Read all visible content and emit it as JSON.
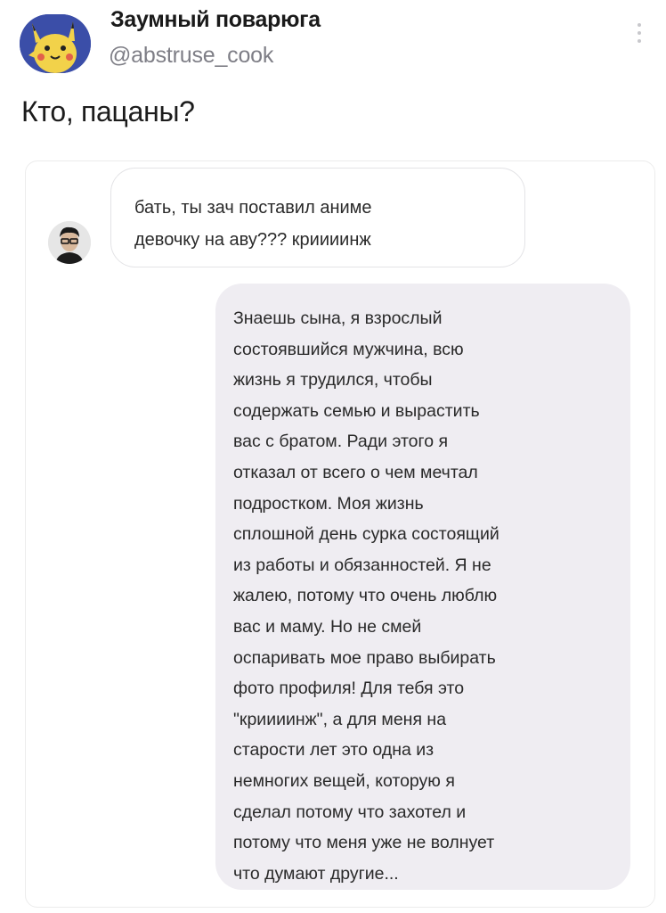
{
  "post": {
    "author_name": "Заумный поварюга",
    "author_handle": "@abstruse_cook",
    "avatar_icon": "pikachu-avatar-icon",
    "more_icon": "more-vertical-icon",
    "text": "Кто, пацаны?"
  },
  "chat": {
    "friend_avatar_icon": "user-avatar-icon",
    "incoming_message": "бать, ты зач поставил аниме\nдевочку на аву??? криииинж",
    "outgoing_message": "Знаешь сына, я взрослый\nсостоявшийся мужчина, всю\nжизнь я трудился, чтобы\nсодержать семью и вырастить\nвас с братом. Ради этого я\nотказал от всего о чем мечтал\nподростком. Моя жизнь\nсплошной день сурка состоящий\nиз работы и обязанностей. Я не\nжалею, потому что очень люблю\nвас и маму. Но не смей\nоспаривать мое право выбирать\nфото профиля! Для тебя это\n\"криииинж\", а для меня на\nстарости лет это одна из\nнемногих вещей, которую я\nсделал потому что захотел и\nпотому что меня уже не волнует\nчто думают другие..."
  },
  "colors": {
    "avatar_bg": "#3b4ea8",
    "pikachu_yellow": "#f2d24a",
    "handle_gray": "#7e7e86",
    "outgoing_bubble": "#efedf2"
  }
}
